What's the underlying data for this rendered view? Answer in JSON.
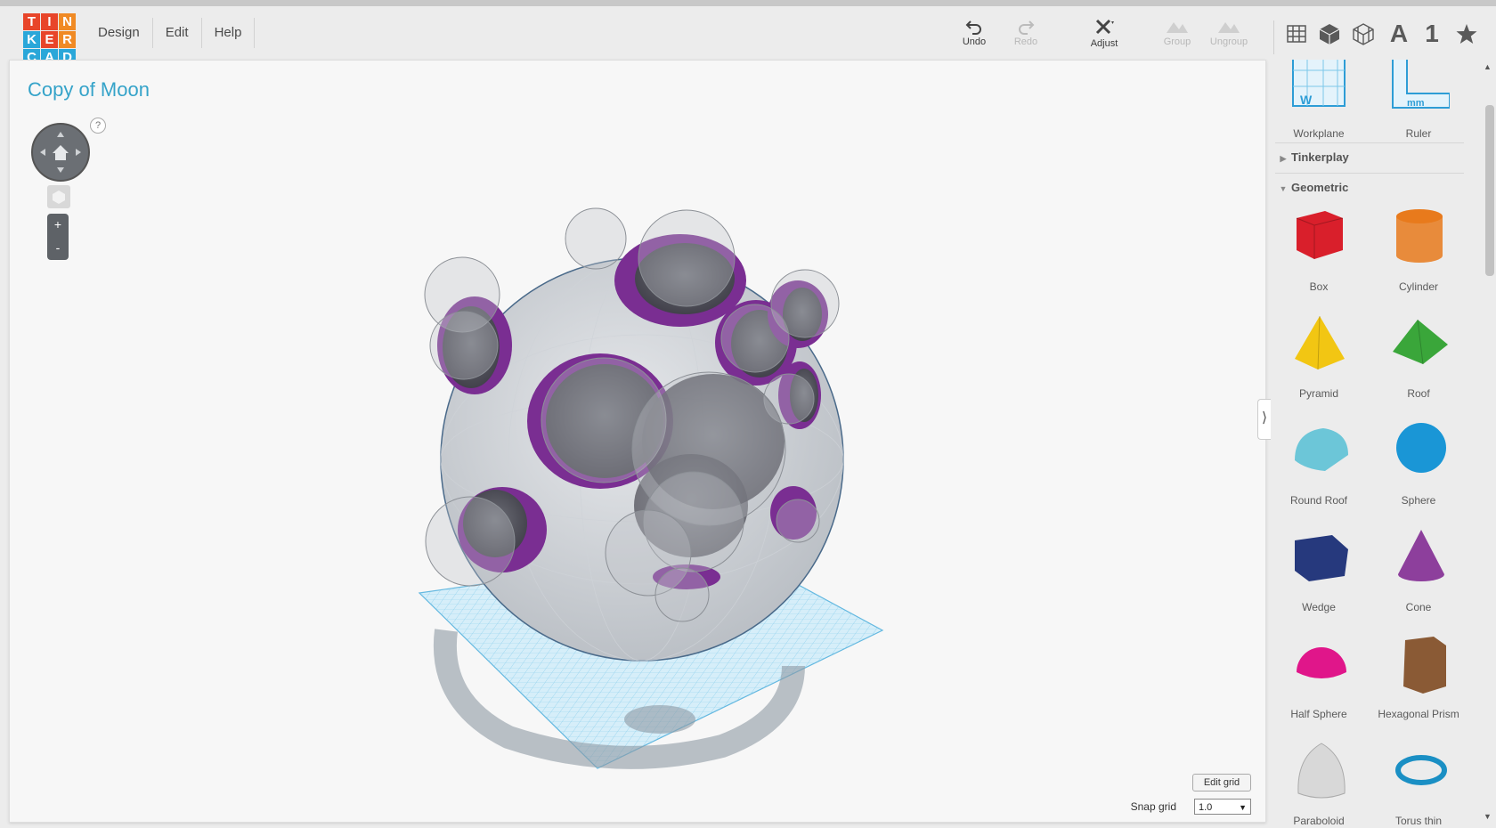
{
  "app": {
    "logo_letters": [
      "T",
      "I",
      "N",
      "K",
      "E",
      "R",
      "C",
      "A",
      "D"
    ],
    "logo_colors": [
      "#e8452a",
      "#e8452a",
      "#f08a24",
      "#2aa7d9",
      "#e8452a",
      "#f08a24",
      "#2aa7d9",
      "#2aa7d9",
      "#2aa7d9"
    ]
  },
  "menu": {
    "design": "Design",
    "edit": "Edit",
    "help": "Help"
  },
  "toolbar": {
    "undo": "Undo",
    "redo": "Redo",
    "adjust": "Adjust",
    "group": "Group",
    "ungroup": "Ungroup",
    "text_icon": "A",
    "number_icon": "1"
  },
  "canvas": {
    "title": "Copy of Moon",
    "help": "?",
    "zoom_in": "+",
    "zoom_out": "-",
    "edit_grid": "Edit grid",
    "snap_label": "Snap grid",
    "snap_value": "1.0",
    "collapse": "⟩"
  },
  "sidebar": {
    "helpers": [
      {
        "label": "Workplane"
      },
      {
        "label": "Ruler"
      }
    ],
    "sections": [
      {
        "label": "Tinkerplay",
        "expanded": false
      },
      {
        "label": "Geometric",
        "expanded": true
      }
    ],
    "shapes": [
      {
        "label": "Box",
        "color": "#d91f2b"
      },
      {
        "label": "Cylinder",
        "color": "#e87a1c"
      },
      {
        "label": "Pyramid",
        "color": "#f2c613"
      },
      {
        "label": "Roof",
        "color": "#3aa63a"
      },
      {
        "label": "Round Roof",
        "color": "#6cc6d8"
      },
      {
        "label": "Sphere",
        "color": "#1a96d6"
      },
      {
        "label": "Wedge",
        "color": "#26397d"
      },
      {
        "label": "Cone",
        "color": "#8d3f9c"
      },
      {
        "label": "Half Sphere",
        "color": "#e0168a"
      },
      {
        "label": "Hexagonal Prism",
        "color": "#8a5a35"
      },
      {
        "label": "Paraboloid",
        "color": "#d8d8d8"
      },
      {
        "label": "Torus thin",
        "color": "#1a8fc4"
      }
    ]
  }
}
